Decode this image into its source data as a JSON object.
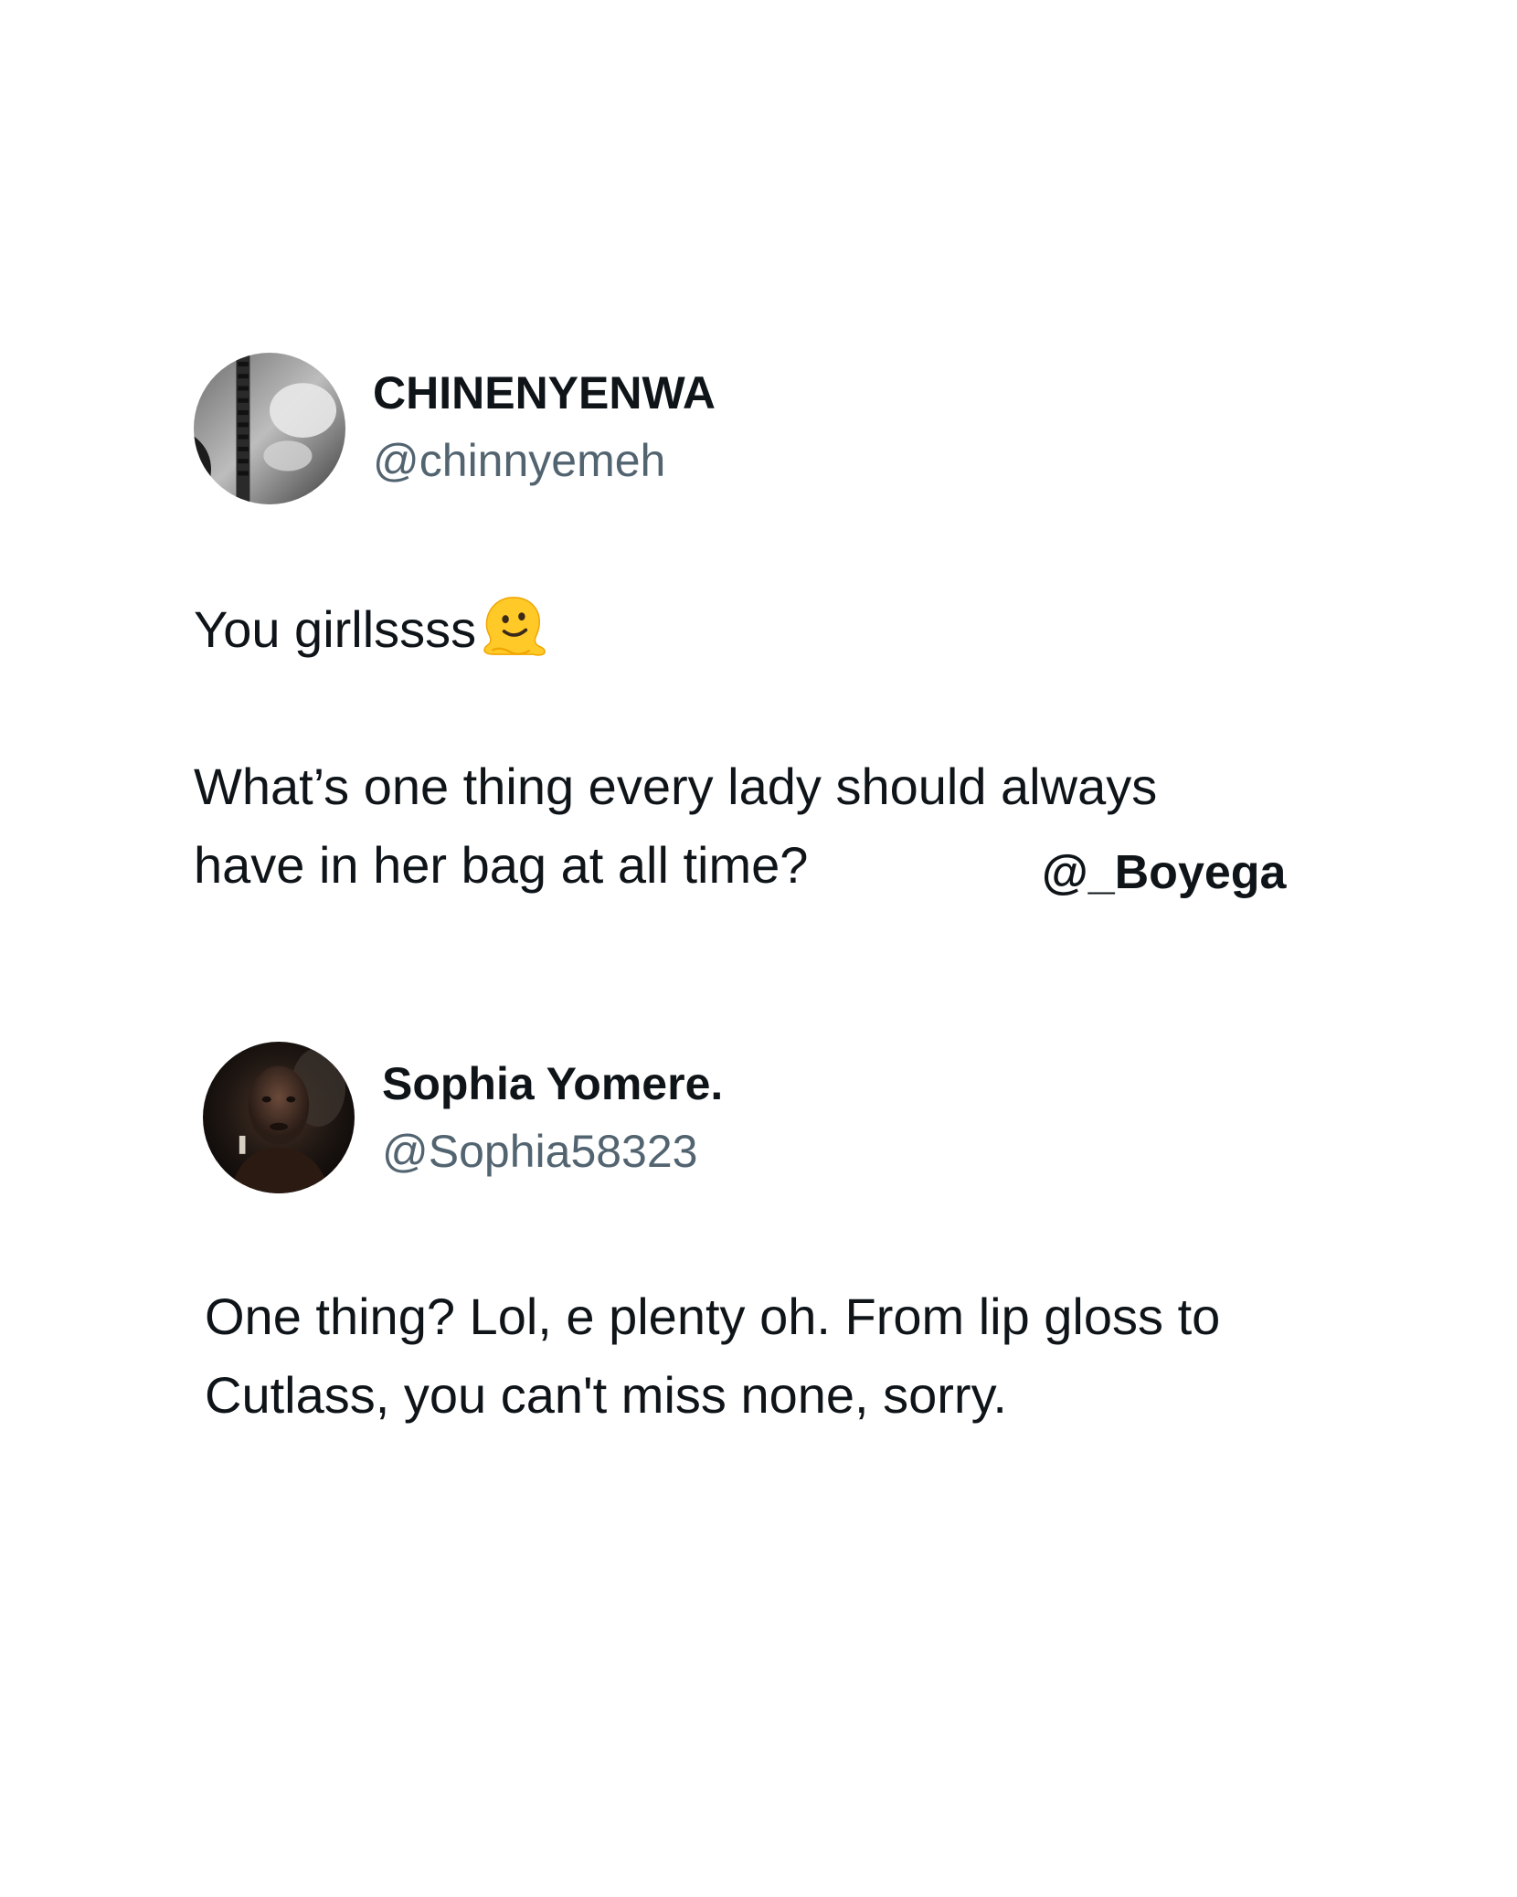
{
  "post_1": {
    "display_name": "CHINENYENWA",
    "handle": "@chinnyemeh",
    "text_line_1": "You girllssss",
    "emoji_icon": "melting-face-emoji",
    "text_line_2": "What’s one thing every lady should always",
    "text_line_3": "have in her bag at all time?"
  },
  "watermark": "@_Boyega",
  "post_2": {
    "display_name": "Sophia Yomere.",
    "handle": "@Sophia58323",
    "text_line_1": "One thing? Lol, e plenty oh. From lip gloss to",
    "text_line_2": "Cutlass, you can't miss none, sorry."
  },
  "colors": {
    "background": "#ffffff",
    "text": "#0f1419",
    "handle": "#536471"
  }
}
